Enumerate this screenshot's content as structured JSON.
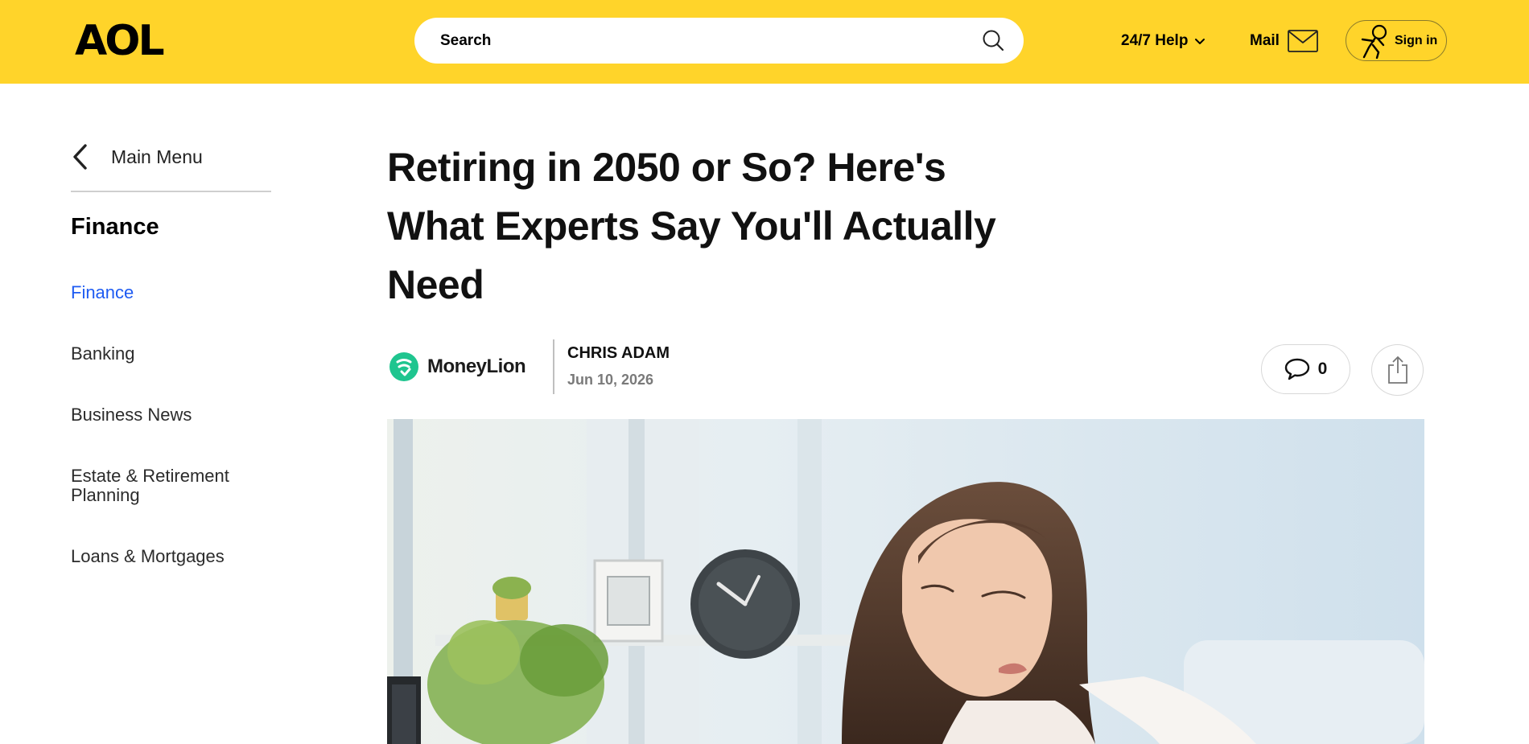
{
  "header": {
    "logo": "AOL",
    "search": {
      "placeholder": "Search"
    },
    "help_label": "24/7 Help",
    "mail_label": "Mail",
    "signin_label": "Sign in",
    "brand_color": "#ffd42a"
  },
  "sidebar": {
    "main_menu_label": "Main Menu",
    "heading": "Finance",
    "items": [
      {
        "label": "Finance",
        "active": true
      },
      {
        "label": "Banking",
        "active": false
      },
      {
        "label": "Business News",
        "active": false
      },
      {
        "label": "Estate & Retirement Planning",
        "active": false
      },
      {
        "label": "Loans & Mortgages",
        "active": false
      }
    ],
    "active_color": "#1e5bf2"
  },
  "article": {
    "title": "Retiring in 2050 or So? Here's What Experts Say You'll Actually Need",
    "source": "MoneyLion",
    "author": "CHRIS ADAM",
    "date": "Jun 10, 2026",
    "comment_count": "0"
  },
  "icons": {
    "search": "search-icon",
    "help_dropdown": "chevron-down-icon",
    "mail": "envelope-icon",
    "signin": "astronaut-icon",
    "back": "chevron-left-icon",
    "comments": "speech-bubble-icon",
    "share": "share-icon",
    "source_logo": "moneylion-logo"
  }
}
